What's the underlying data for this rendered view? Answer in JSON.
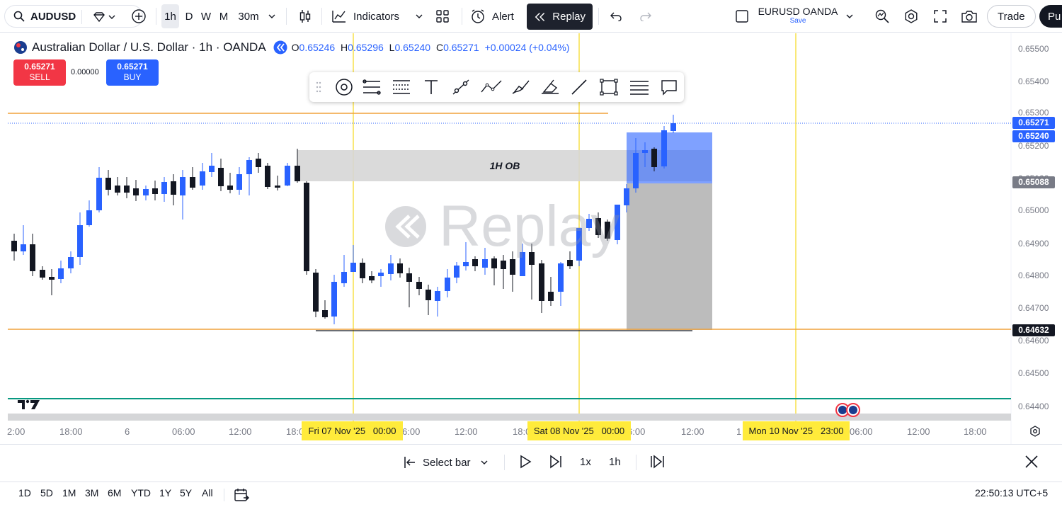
{
  "topbar": {
    "symbol": "AUDUSD",
    "timeframes": [
      "1h",
      "D",
      "W",
      "M",
      "30m"
    ],
    "indicators_label": "Indicators",
    "alert_label": "Alert",
    "replay_label": "Replay",
    "layout_name": "EURUSD OANDA",
    "layout_save": "Save",
    "trade_label": "Trade",
    "publish_label": "Pu"
  },
  "legend": {
    "title": "Australian Dollar / U.S. Dollar · 1h · OANDA",
    "o_label": "O",
    "o": "0.65246",
    "h_label": "H",
    "h": "0.65296",
    "l_label": "L",
    "l": "0.65240",
    "c_label": "C",
    "c": "0.65271",
    "change": "+0.00024 (+0.04%)",
    "sell_price": "0.65271",
    "sell_label": "SELL",
    "spread": "0.00000",
    "buy_price": "0.65271",
    "buy_label": "BUY"
  },
  "chart": {
    "ob_label": "1H OB",
    "watermark": "Replay",
    "price_axis": [
      "0.65500",
      "0.65400",
      "0.65300",
      "0.65200",
      "0.65100",
      "0.65000",
      "0.64900",
      "0.64800",
      "0.64700",
      "0.64600",
      "0.64500",
      "0.64400"
    ],
    "price_boxes": [
      {
        "value": "0.65271",
        "color": "#2962ff"
      },
      {
        "value": "0.65240",
        "color": "#2962ff"
      },
      {
        "value": "0.65088",
        "color": "#787b86"
      },
      {
        "value": "0.64632",
        "color": "#131722"
      }
    ],
    "time_axis": [
      "2:00",
      "18:00",
      "6",
      "06:00",
      "12:00",
      "18:0",
      "6:00",
      "12:00",
      "18:00",
      "6:00",
      "12:00",
      "1",
      "06:00",
      "12:00",
      "18:00"
    ],
    "time_boxes": [
      "Fri 07 Nov '25   00:00",
      "Sat 08 Nov '25   00:00",
      "Mon 10 Nov '25   23:00"
    ],
    "colors": {
      "up": "#2962ff",
      "down": "#131722",
      "level": "#f0a23b",
      "vline": "#f7e04a",
      "green": "#089981"
    }
  },
  "replay_bar": {
    "select_bar": "Select bar",
    "speed": "1x",
    "interval": "1h"
  },
  "range_bar": {
    "ranges": [
      "1D",
      "5D",
      "1M",
      "3M",
      "6M",
      "YTD",
      "1Y",
      "5Y",
      "All"
    ],
    "clock": "22:50:13 UTC+5"
  }
}
